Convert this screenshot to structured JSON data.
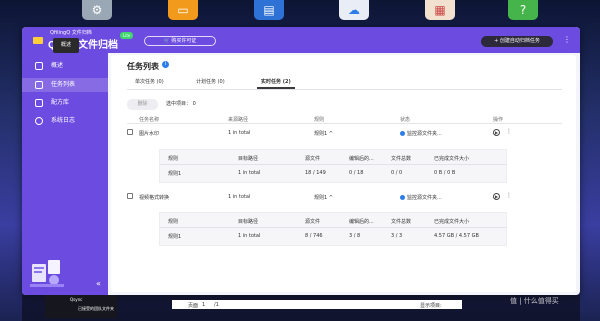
{
  "window": {
    "app_title": "QfilingQ 文件归档",
    "brand": "QfiNg 文件归档",
    "lite_badge": "Lite",
    "buy_button": "购买许可证",
    "create_button": "+ 创建自动归档任务",
    "tooltip": "概述"
  },
  "sidebar": {
    "items": [
      {
        "label": "概述",
        "icon": "home-icon"
      },
      {
        "label": "任务列表",
        "icon": "list-icon"
      },
      {
        "label": "配方库",
        "icon": "library-icon"
      },
      {
        "label": "系统日志",
        "icon": "log-icon"
      }
    ],
    "collapse": "«"
  },
  "main": {
    "title": "任务列表",
    "tabs": [
      {
        "label": "单次任务 (0)"
      },
      {
        "label": "计划任务 (0)"
      },
      {
        "label": "实时任务 (2)"
      }
    ],
    "delete_button": "删除",
    "selected_text": "选中项目： 0",
    "columns": [
      "任务名称",
      "来源路径",
      "规则",
      "状态",
      "操作"
    ],
    "rows": [
      {
        "name": "图片水印",
        "source": "1 in total",
        "rule": "规则1 ^",
        "status": "监控源文件夹...",
        "sub_columns": [
          "规则",
          "目标路径",
          "源文件",
          "编辑后的...",
          "文件总数",
          "已完成文件大小"
        ],
        "sub_row": [
          "规则1",
          "1 in total",
          "18 / 149",
          "0 / 18",
          "0 / 0",
          "0 B / 0 B"
        ]
      },
      {
        "name": "视频格式转换",
        "source": "1 in total",
        "rule": "规则1 ^",
        "status": "监控源文件夹...",
        "sub_columns": [
          "规则",
          "目标路径",
          "源文件",
          "编辑后的...",
          "文件总数",
          "已完成文件大小"
        ],
        "sub_row": [
          "规则1",
          "1 in total",
          "8 / 746",
          "3 / 8",
          "3 / 3",
          "4.57 GB / 4.57 GB"
        ]
      }
    ]
  },
  "taskbar": {
    "app_name": "Qsync",
    "folder_label": "已接受的团队文件夹",
    "pager_page": "页面",
    "pager_value": "1",
    "pager_total": "/1",
    "pager_right": "显示项目:",
    "watermark": "值 | 什么值得买"
  },
  "colors": {
    "accent": "#6c4be0",
    "primary_blue": "#2b7de9",
    "lite_green": "#3ed46e"
  }
}
